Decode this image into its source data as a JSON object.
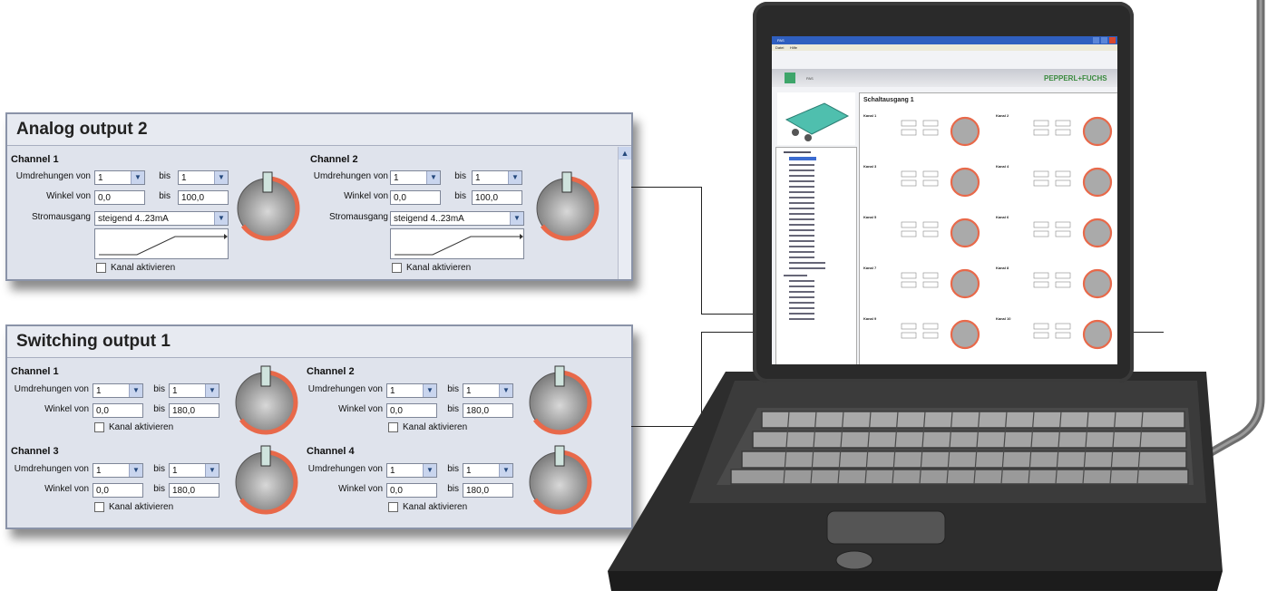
{
  "analog_panel": {
    "title": "Analog output 2",
    "channels": [
      {
        "title": "Channel 1",
        "rotations_label": "Umdrehungen von",
        "rotations_from": "1",
        "bis_label": "bis",
        "rotations_to": "1",
        "angle_label": "Winkel von",
        "angle_from": "0,0",
        "angle_to": "100,0",
        "output_label": "Stromausgang",
        "output_value": "steigend 4..23mA",
        "activate_label": "Kanal aktivieren"
      },
      {
        "title": "Channel 2",
        "rotations_label": "Umdrehungen von",
        "rotations_from": "1",
        "bis_label": "bis",
        "rotations_to": "1",
        "angle_label": "Winkel von",
        "angle_from": "0,0",
        "angle_to": "100,0",
        "output_label": "Stromausgang",
        "output_value": "steigend 4..23mA",
        "activate_label": "Kanal aktivieren"
      }
    ]
  },
  "switching_panel": {
    "title": "Switching output 1",
    "channels": [
      {
        "title": "Channel 1",
        "rotations_label": "Umdrehungen von",
        "rotations_from": "1",
        "bis_label": "bis",
        "rotations_to": "1",
        "angle_label": "Winkel von",
        "angle_from": "0,0",
        "angle_to": "180,0",
        "activate_label": "Kanal aktivieren"
      },
      {
        "title": "Channel 2",
        "rotations_label": "Umdrehungen von",
        "rotations_from": "1",
        "bis_label": "bis",
        "rotations_to": "1",
        "angle_label": "Winkel von",
        "angle_from": "0,0",
        "angle_to": "180,0",
        "activate_label": "Kanal aktivieren"
      },
      {
        "title": "Channel 3",
        "rotations_label": "Umdrehungen von",
        "rotations_from": "1",
        "bis_label": "bis",
        "rotations_to": "1",
        "angle_label": "Winkel von",
        "angle_from": "0,0",
        "angle_to": "180,0",
        "activate_label": "Kanal aktivieren"
      },
      {
        "title": "Channel 4",
        "rotations_label": "Umdrehungen von",
        "rotations_from": "1",
        "bis_label": "bis",
        "rotations_to": "1",
        "angle_label": "Winkel von",
        "angle_from": "0,0",
        "angle_to": "180,0",
        "activate_label": "Kanal aktivieren"
      }
    ]
  },
  "laptop_app": {
    "window_title": "PAS",
    "menu": [
      "Datei",
      "Hilfe"
    ],
    "banner_label": "PAS",
    "brand": "PEPPERL+FUCHS",
    "content_title": "Schaltausgang 1",
    "channels": [
      "Kanal 1",
      "Kanal 2",
      "Kanal 3",
      "Kanal 4",
      "Kanal 5",
      "Kanal 6",
      "Kanal 7",
      "Kanal 8",
      "Kanal 9",
      "Kanal 10"
    ]
  },
  "colors": {
    "panel_bg": "#dfe3ec",
    "knob_ring": "#e8694a",
    "brand_green": "#3ea56a"
  }
}
